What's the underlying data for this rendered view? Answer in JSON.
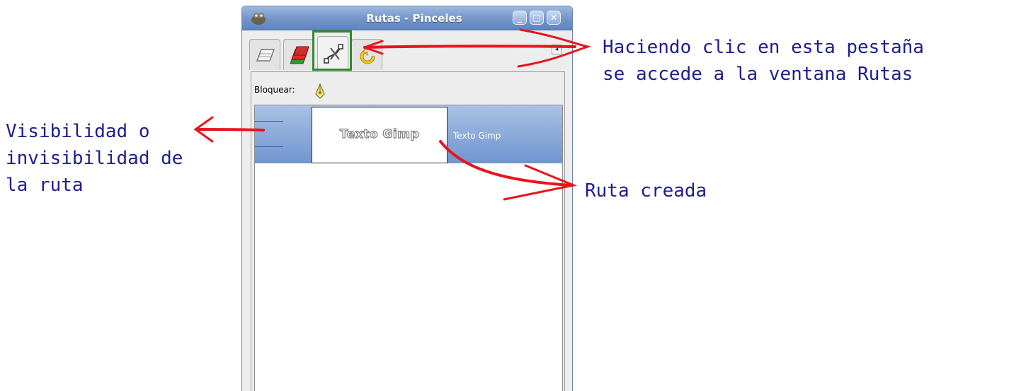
{
  "window": {
    "title": "Rutas - Pinceles",
    "controls": {
      "minimize": "_",
      "maximize": "□",
      "close": "✕"
    },
    "tabs": [
      {
        "icon": "layers-tab-icon",
        "active": false
      },
      {
        "icon": "channels-tab-icon",
        "active": false
      },
      {
        "icon": "paths-tab-icon",
        "active": true
      },
      {
        "icon": "undo-history-tab-icon",
        "active": false
      }
    ],
    "tab_menu_glyph": "◂",
    "lock_label": "Bloquear:",
    "paths": [
      {
        "thumbnail_text": "Texto Gimp",
        "name": "Texto Gimp",
        "selected": true
      }
    ]
  },
  "annotations": {
    "tab_note": {
      "line1": "Haciendo clic en esta pestaña",
      "line2": "se accede a la ventana Rutas"
    },
    "visibility_note": {
      "line1": "Visibilidad o",
      "line2": "invisibilidad de",
      "line3": "la ruta"
    },
    "path_note": "Ruta creada"
  },
  "colors": {
    "annotation_text": "#1e1e8c",
    "arrow": "#e8141b",
    "highlight_box": "#2f8c2a",
    "selected_row": "#7f9fd4"
  }
}
